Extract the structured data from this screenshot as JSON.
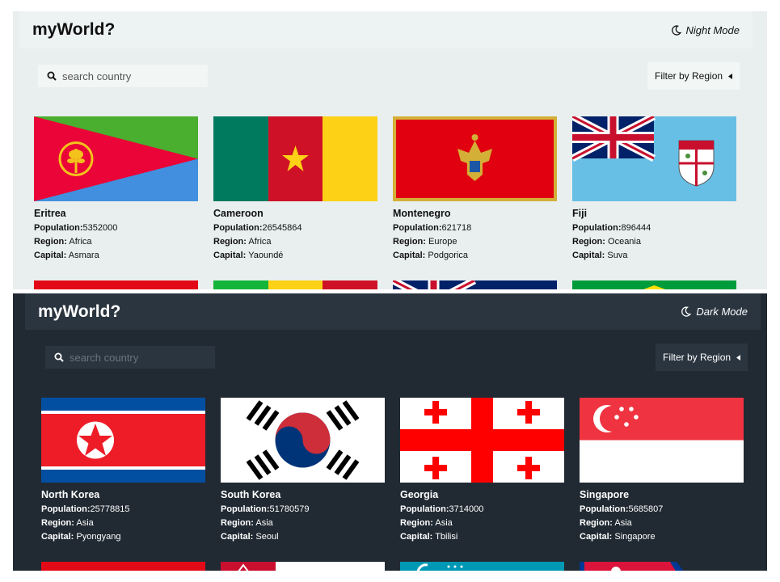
{
  "light": {
    "brand": "myWorld?",
    "mode_label": "Night Mode",
    "search_placeholder": "search country",
    "filter_label": "Filter by Region",
    "countries": [
      {
        "name": "Eritrea",
        "population": "5352000",
        "region": "Africa",
        "capital": "Asmara"
      },
      {
        "name": "Cameroon",
        "population": "26545864",
        "region": "Africa",
        "capital": "Yaoundé"
      },
      {
        "name": "Montenegro",
        "population": "621718",
        "region": "Europe",
        "capital": "Podgorica"
      },
      {
        "name": "Fiji",
        "population": "896444",
        "region": "Oceania",
        "capital": "Suva"
      }
    ]
  },
  "dark": {
    "brand": "myWorld?",
    "mode_label": "Dark Mode",
    "search_placeholder": "search country",
    "filter_label": "Filter by Region",
    "countries": [
      {
        "name": "North Korea",
        "population": "25778815",
        "region": "Asia",
        "capital": "Pyongyang"
      },
      {
        "name": "South Korea",
        "population": "51780579",
        "region": "Asia",
        "capital": "Seoul"
      },
      {
        "name": "Georgia",
        "population": "3714000",
        "region": "Asia",
        "capital": "Tbilisi"
      },
      {
        "name": "Singapore",
        "population": "5685807",
        "region": "Asia",
        "capital": "Singapore"
      }
    ]
  },
  "labels": {
    "population": "Population:",
    "region": "Region:",
    "capital": "Capital:"
  },
  "colors": {
    "light_bg": "#e8efee",
    "dark_bg": "#212a33",
    "dark_element": "#2b3540"
  }
}
